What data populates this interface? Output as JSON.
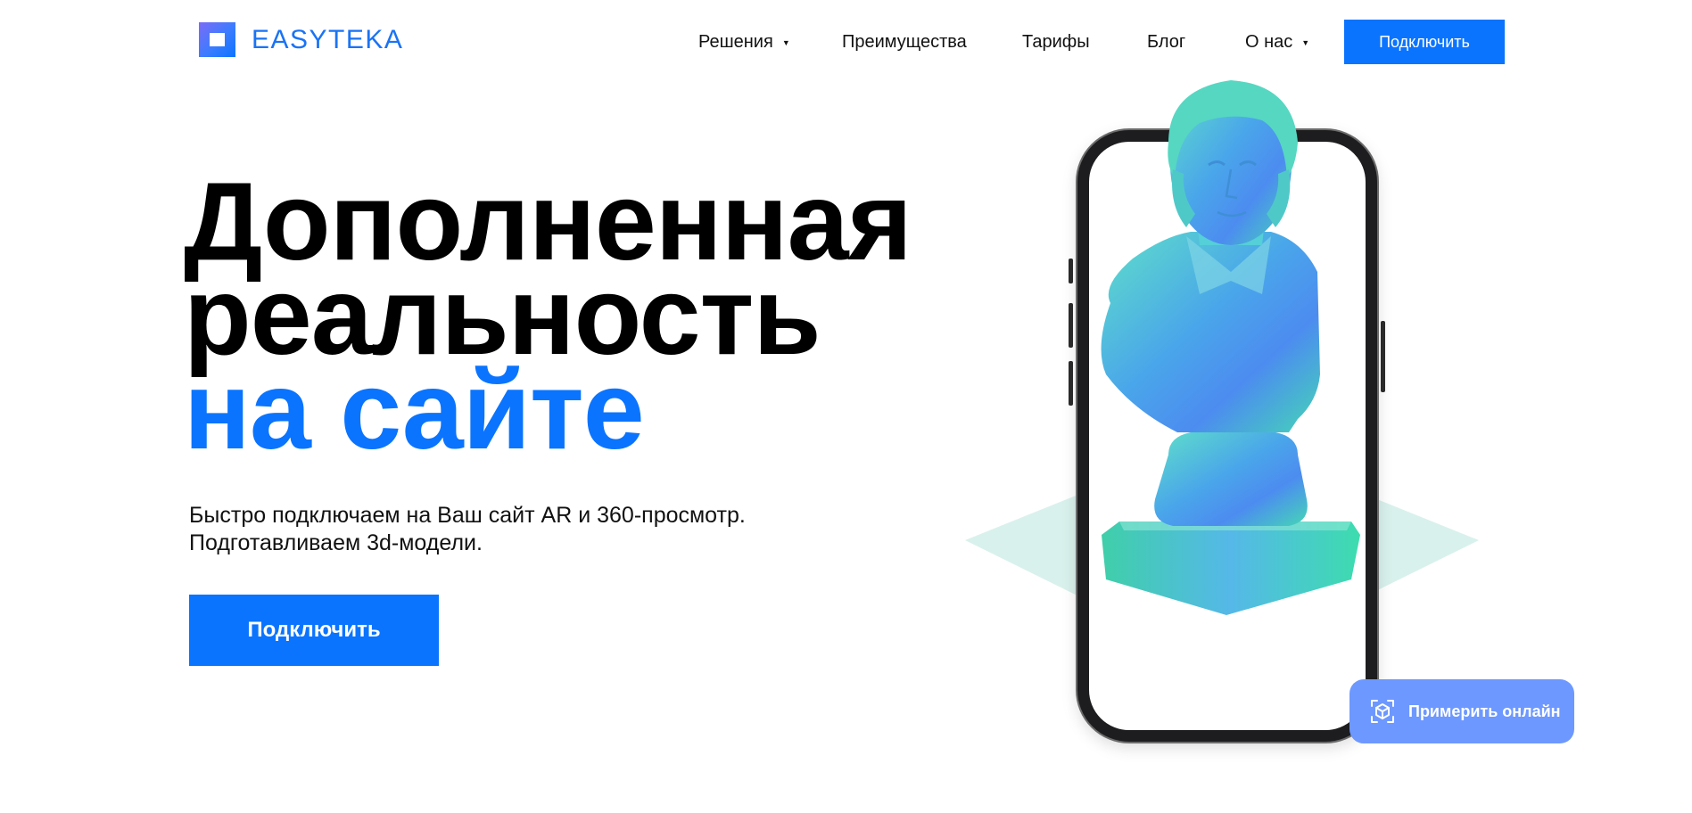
{
  "header": {
    "logo_text": "EASYTEKA",
    "nav": [
      {
        "label": "Решения",
        "has_dropdown": true
      },
      {
        "label": "Преимущества",
        "has_dropdown": false
      },
      {
        "label": "Тарифы",
        "has_dropdown": false
      },
      {
        "label": "Блог",
        "has_dropdown": false
      },
      {
        "label": "О нас",
        "has_dropdown": true
      }
    ],
    "cta_label": "Подключить"
  },
  "hero": {
    "title_line1": "Дополненная",
    "title_line2": "реальность",
    "title_line3": "на сайте",
    "subtitle_line1": "Быстро подключаем на Ваш сайт AR и 360-просмотр.",
    "subtitle_line2": "Подготавливаем 3d-модели.",
    "cta_label": "Подключить"
  },
  "widget": {
    "try_label": "Примерить онлайн",
    "icon": "ar-cube-icon"
  },
  "colors": {
    "accent": "#0a74ff",
    "widget": "#6d98ff",
    "floor": "#d9f1ec"
  }
}
